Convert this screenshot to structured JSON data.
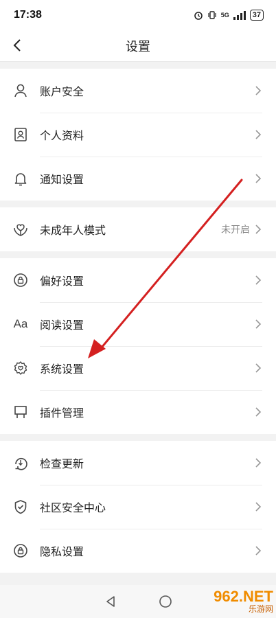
{
  "status": {
    "time": "17:38",
    "network": "5G",
    "battery": "37"
  },
  "header": {
    "title": "设置"
  },
  "groups": [
    {
      "items": [
        {
          "label": "账户安全",
          "icon": "person-icon"
        },
        {
          "label": "个人资料",
          "icon": "profile-card-icon"
        },
        {
          "label": "通知设置",
          "icon": "bell-icon"
        }
      ]
    },
    {
      "items": [
        {
          "label": "未成年人模式",
          "icon": "heart-hands-icon",
          "value": "未开启"
        }
      ]
    },
    {
      "items": [
        {
          "label": "偏好设置",
          "icon": "lock-circle-icon"
        },
        {
          "label": "阅读设置",
          "icon": "font-aa-icon",
          "glyph": "Aa"
        },
        {
          "label": "系统设置",
          "icon": "gear-heart-icon"
        },
        {
          "label": "插件管理",
          "icon": "plugin-icon"
        }
      ]
    },
    {
      "items": [
        {
          "label": "检查更新",
          "icon": "refresh-download-icon"
        },
        {
          "label": "社区安全中心",
          "icon": "shield-check-icon"
        },
        {
          "label": "隐私设置",
          "icon": "lock-circle-icon"
        }
      ]
    }
  ],
  "watermark": {
    "top": "962.NET",
    "bottom": "乐游网"
  },
  "colors": {
    "annotation_arrow": "#d42020",
    "watermark": "#f08c00"
  }
}
